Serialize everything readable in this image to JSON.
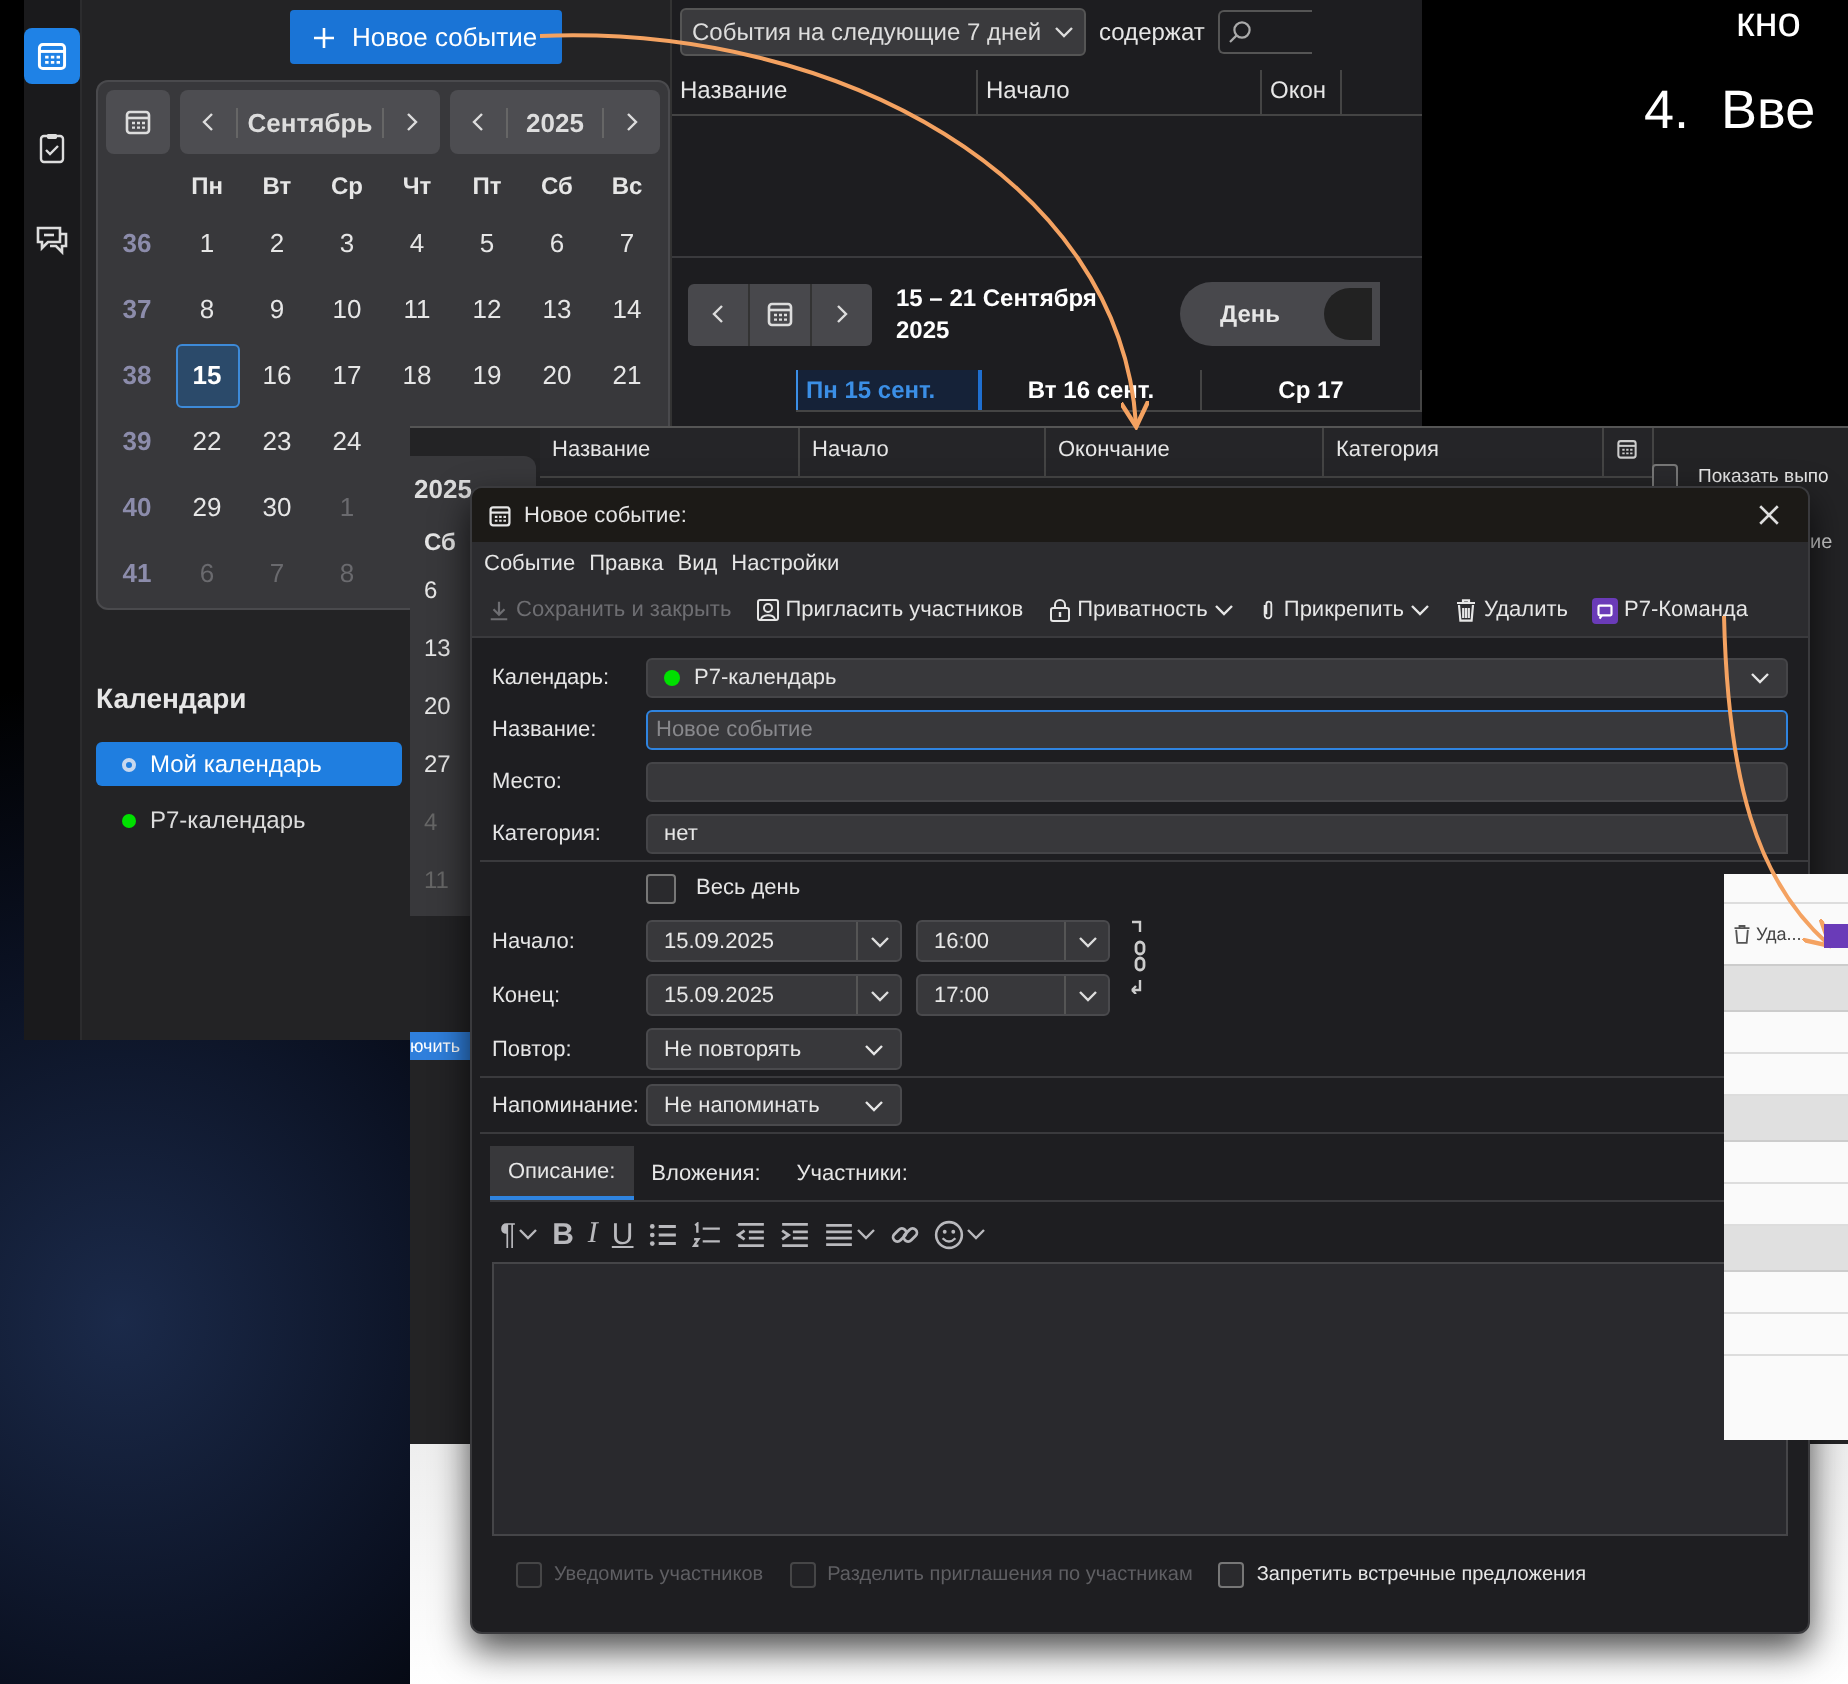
{
  "slide": {
    "line_1": "кно",
    "list_item": {
      "number": "4.",
      "text": "Вве"
    }
  },
  "calendar_window": {
    "rail": [
      {
        "kind": "calendar",
        "selected": true
      },
      {
        "kind": "tasks",
        "selected": false
      },
      {
        "kind": "chat",
        "selected": false
      }
    ],
    "new_event_button": "Новое событие",
    "mini_calendar": {
      "month": "Сентябрь",
      "year": "2025",
      "weekdays": [
        "Пн",
        "Вт",
        "Ср",
        "Чт",
        "Пт",
        "Сб",
        "Вс"
      ],
      "weeks": [
        {
          "number": "36",
          "days": [
            {
              "day": "1",
              "other_month": false,
              "selected": false
            },
            {
              "day": "2",
              "other_month": false,
              "selected": false
            },
            {
              "day": "3",
              "other_month": false,
              "selected": false
            },
            {
              "day": "4",
              "other_month": false,
              "selected": false
            },
            {
              "day": "5",
              "other_month": false,
              "selected": false
            },
            {
              "day": "6",
              "other_month": false,
              "selected": false
            },
            {
              "day": "7",
              "other_month": false,
              "selected": false
            }
          ]
        },
        {
          "number": "37",
          "days": [
            {
              "day": "8",
              "other_month": false,
              "selected": false
            },
            {
              "day": "9",
              "other_month": false,
              "selected": false
            },
            {
              "day": "10",
              "other_month": false,
              "selected": false
            },
            {
              "day": "11",
              "other_month": false,
              "selected": false
            },
            {
              "day": "12",
              "other_month": false,
              "selected": false
            },
            {
              "day": "13",
              "other_month": false,
              "selected": false
            },
            {
              "day": "14",
              "other_month": false,
              "selected": false
            }
          ]
        },
        {
          "number": "38",
          "days": [
            {
              "day": "15",
              "other_month": false,
              "selected": true
            },
            {
              "day": "16",
              "other_month": false,
              "selected": false
            },
            {
              "day": "17",
              "other_month": false,
              "selected": false
            },
            {
              "day": "18",
              "other_month": false,
              "selected": false
            },
            {
              "day": "19",
              "other_month": false,
              "selected": false
            },
            {
              "day": "20",
              "other_month": false,
              "selected": false
            },
            {
              "day": "21",
              "other_month": false,
              "selected": false
            }
          ]
        },
        {
          "number": "39",
          "days": [
            {
              "day": "22",
              "other_month": false,
              "selected": false
            },
            {
              "day": "23",
              "other_month": false,
              "selected": false
            },
            {
              "day": "24",
              "other_month": false,
              "selected": false
            }
          ]
        },
        {
          "number": "40",
          "days": [
            {
              "day": "29",
              "other_month": false,
              "selected": false
            },
            {
              "day": "30",
              "other_month": false,
              "selected": false
            },
            {
              "day": "1",
              "other_month": true,
              "selected": false
            }
          ]
        },
        {
          "number": "41",
          "days": [
            {
              "day": "6",
              "other_month": true,
              "selected": false
            },
            {
              "day": "7",
              "other_month": true,
              "selected": false
            },
            {
              "day": "8",
              "other_month": true,
              "selected": false
            }
          ]
        }
      ]
    },
    "calendars_heading": "Календари",
    "calendars": [
      {
        "name": "Мой календарь",
        "kind": "ring",
        "color": "#c8d8ee",
        "selected": true
      },
      {
        "name": "Р7-календарь",
        "kind": "dot",
        "color": "#00e000",
        "selected": false
      }
    ],
    "filter": {
      "value": "События на следующие 7 дней",
      "label": "содержат"
    },
    "table_columns": [
      "Название",
      "Начало",
      "Окон"
    ],
    "range": "15 – 21 Сентября\n2025",
    "view_toggle": "День",
    "day_headers": [
      {
        "label": "Пн 15 сент.",
        "selected": true
      },
      {
        "label": "Вт 16 сент.",
        "selected": false
      },
      {
        "label": "Ср 17",
        "selected": false
      }
    ]
  },
  "events_window": {
    "year": "2025",
    "weekday": "Сб",
    "days": [
      {
        "day": "6",
        "other_month": false
      },
      {
        "day": "13",
        "other_month": false
      },
      {
        "day": "20",
        "other_month": false
      },
      {
        "day": "27",
        "other_month": false
      },
      {
        "day": "4",
        "other_month": true
      },
      {
        "day": "11",
        "other_month": true
      }
    ],
    "button_fragment": "ючить",
    "table_columns": [
      "Название",
      "Начало",
      "Окончание",
      "Категория"
    ],
    "show_completed": {
      "label": "Показать выпо",
      "checked": false
    },
    "list_column": "ие"
  },
  "event_dialog": {
    "title": "Новое событие:",
    "menu": [
      "Событие",
      "Правка",
      "Вид",
      "Настройки"
    ],
    "toolbar": [
      {
        "kind": "save",
        "label": "Сохранить и закрыть",
        "disabled": true,
        "dropdown": false
      },
      {
        "kind": "invite",
        "label": "Пригласить участников",
        "disabled": false,
        "dropdown": false
      },
      {
        "kind": "lock",
        "label": "Приватность",
        "disabled": false,
        "dropdown": true
      },
      {
        "kind": "clip",
        "label": "Прикрепить",
        "disabled": false,
        "dropdown": true
      },
      {
        "kind": "trash",
        "label": "Удалить",
        "disabled": false,
        "dropdown": false
      },
      {
        "kind": "team",
        "label": "Р7-Команда",
        "disabled": false,
        "dropdown": false
      }
    ],
    "calendar": {
      "label": "Календарь:",
      "value": "Р7-календарь",
      "color": "#00e000"
    },
    "title_field": {
      "label": "Название:",
      "placeholder": "Новое событие"
    },
    "location": {
      "label": "Место:"
    },
    "category": {
      "label": "Категория:",
      "value": "нет"
    },
    "all_day": {
      "label": "Весь день",
      "checked": false
    },
    "start": {
      "label": "Начало:",
      "date": "15.09.2025",
      "time": "16:00"
    },
    "end": {
      "label": "Конец:",
      "date": "15.09.2025",
      "time": "17:00"
    },
    "repeat": {
      "label": "Повтор:",
      "value": "Не повторять"
    },
    "reminder": {
      "label": "Напоминание:",
      "value": "Не напоминать"
    },
    "tabs": [
      {
        "label": "Описание:",
        "selected": true
      },
      {
        "label": "Вложения:",
        "selected": false
      },
      {
        "label": "Участники:",
        "selected": false
      }
    ],
    "format_tools": [
      {
        "kind": "paragraph",
        "label": "¶",
        "dropdown": true
      },
      {
        "kind": "bold",
        "label": "B",
        "dropdown": false
      },
      {
        "kind": "italic",
        "label": "I",
        "dropdown": false
      },
      {
        "kind": "underline",
        "label": "U",
        "dropdown": false
      },
      {
        "kind": "bullets",
        "dropdown": false
      },
      {
        "kind": "numbers",
        "dropdown": false
      },
      {
        "kind": "outdent",
        "dropdown": false
      },
      {
        "kind": "indent",
        "dropdown": false
      },
      {
        "kind": "align",
        "dropdown": true
      },
      {
        "kind": "link",
        "dropdown": false
      },
      {
        "kind": "emoji",
        "dropdown": true
      }
    ],
    "options": [
      {
        "label": "Уведомить участников",
        "checked": false,
        "disabled": true
      },
      {
        "label": "Разделить приглашения по участникам",
        "checked": false,
        "disabled": true
      },
      {
        "label": "Запретить встречные предложения",
        "checked": false,
        "disabled": false
      }
    ]
  },
  "light_window": {
    "delete_label": "Уда..."
  }
}
